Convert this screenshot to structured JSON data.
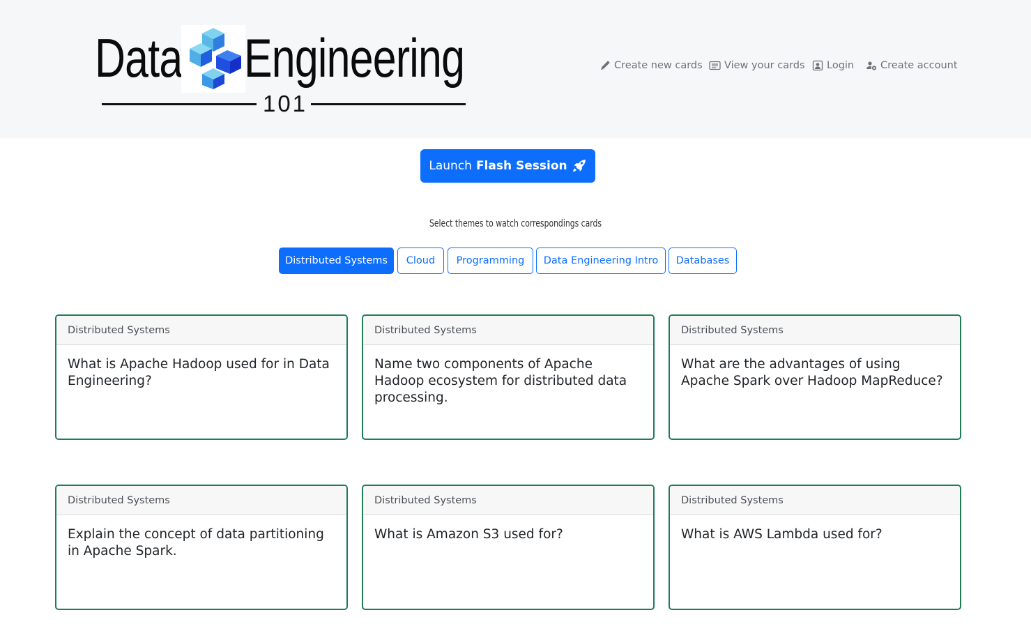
{
  "header": {
    "logo": {
      "word1": "Data",
      "word2": "Engineering",
      "sub": "101"
    },
    "nav": [
      {
        "label": "Create new cards",
        "icon": "pencil-icon"
      },
      {
        "label": "View your cards",
        "icon": "card-list-icon"
      },
      {
        "label": "Login",
        "icon": "person-badge-icon"
      },
      {
        "label": "Create account",
        "icon": "person-gear-icon"
      }
    ]
  },
  "launch": {
    "prefix": "Launch",
    "bold": "Flash Session",
    "icon": "rocket-icon"
  },
  "themes": {
    "prompt": "Select themes to watch correspondings cards",
    "items": [
      {
        "label": "Distributed Systems",
        "active": true
      },
      {
        "label": "Cloud",
        "active": false
      },
      {
        "label": "Programming",
        "active": false
      },
      {
        "label": "Data Engineering Intro",
        "active": false
      },
      {
        "label": "Databases",
        "active": false
      }
    ]
  },
  "cards": [
    {
      "theme": "Distributed Systems",
      "question": "What is Apache Hadoop used for in Data Engineering?"
    },
    {
      "theme": "Distributed Systems",
      "question": "Name two components of Apache Hadoop ecosystem for distributed data processing."
    },
    {
      "theme": "Distributed Systems",
      "question": "What are the advantages of using Apache Spark over Hadoop MapReduce?"
    },
    {
      "theme": "Distributed Systems",
      "question": "Explain the concept of data partitioning in Apache Spark."
    },
    {
      "theme": "Distributed Systems",
      "question": "What is Amazon S3 used for?"
    },
    {
      "theme": "Distributed Systems",
      "question": "What is AWS Lambda used for?"
    }
  ],
  "colors": {
    "primary": "#0d6efd",
    "card_border": "#1e7d55",
    "header_bg": "#f6f7f9"
  }
}
